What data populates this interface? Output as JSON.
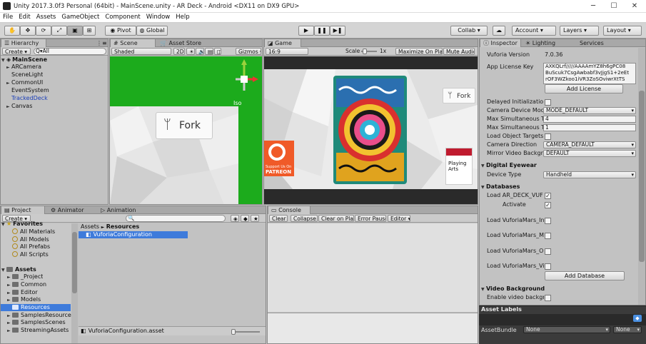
{
  "window": {
    "title": "Unity 2017.3.0f3 Personal (64bit) - MainScene.unity - AR Deck - Android <DX11 on DX9 GPU>"
  },
  "menu": [
    "File",
    "Edit",
    "Assets",
    "GameObject",
    "Component",
    "Window",
    "Help"
  ],
  "toolbar": {
    "pivot": "Pivot",
    "global": "Global",
    "collab": "Collab ▾",
    "account": "Account",
    "layers": "Layers",
    "layout": "Layout"
  },
  "hierarchy": {
    "tab": "Hierarchy",
    "create": "Create ▾",
    "search_placeholder": "Q▾All",
    "scene": "MainScene",
    "items": [
      "ARCamera",
      "SceneLight",
      "CommonUI",
      "EventSystem",
      "TrackedDeck",
      "Canvas"
    ]
  },
  "scene": {
    "tab_scene": "Scene",
    "tab_store": "Asset Store",
    "shaded": "Shaded",
    "mode2d": "2D",
    "gizmos": "Gizmos ▾",
    "search_placeholder": "Q▾All",
    "persp": "Iso",
    "fork": "Fork"
  },
  "game": {
    "tab": "Game",
    "aspect": "16:9",
    "scale_label": "Scale",
    "scale_value": "1x",
    "maximize": "Maximize On Play",
    "mute": "Mute Audio",
    "fork": "Fork",
    "playing_arts": "Playing Arts",
    "patreon_support": "Support Us On",
    "patreon": "PATREON"
  },
  "project": {
    "tab_project": "Project",
    "tab_animator": "Animator",
    "tab_animation": "Animation",
    "create": "Create ▾",
    "favorites_label": "Favorites",
    "favorites": [
      "All Materials",
      "All Models",
      "All Prefabs",
      "All Scripts"
    ],
    "assets_label": "Assets",
    "folders": [
      "_Project",
      "Common",
      "Editor",
      "Models",
      "Resources",
      "SamplesResource",
      "SamplesScenes",
      "StreamingAssets"
    ],
    "breadcrumb_root": "Assets",
    "breadcrumb_sep": "►",
    "breadcrumb_current": "Resources",
    "file": "VuforiaConfiguration",
    "footer_file": "VuforiaConfiguration.asset"
  },
  "console": {
    "tab": "Console",
    "clear": "Clear",
    "collapse": "Collapse",
    "clear_on_play": "Clear on Play",
    "error_pause": "Error Pause",
    "editor": "Editor ▾"
  },
  "inspector": {
    "tab_inspector": "Inspector",
    "tab_lighting": "Lighting",
    "tab_services": "Services",
    "vuforia_version_label": "Vuforia Version",
    "vuforia_version": "7.0.36",
    "license_label": "App License Key",
    "license_lines": [
      "AXKQLrf/////AAAAmYZ8h6gPC08",
      "BuScuk7CsgAwbabf3vJjgS1+2eEt",
      "rOF3WZkoo1iVR3ZoSOviwrXtTS"
    ],
    "add_license": "Add License",
    "delayed_init": "Delayed Initializatio",
    "camera_mode_label": "Camera Device Mod",
    "camera_mode": "MODE_DEFAULT",
    "max_sim1_label": "Max Simultaneous T",
    "max_sim1": "4",
    "max_sim2_label": "Max Simultaneous T",
    "max_sim2": "1",
    "load_targets": "Load Object Targets",
    "camera_dir_label": "Camera Direction",
    "camera_dir": "CAMERA_DEFAULT",
    "mirror_label": "Mirror Video Backgr",
    "mirror": "DEFAULT",
    "digital_eyewear": "Digital Eyewear",
    "device_type_label": "Device Type",
    "device_type": "Handheld",
    "databases": "Databases",
    "load_ar_deck": "Load AR_DECK_VUF",
    "activate": "Activate",
    "load_db1": "Load VuforiaMars_In",
    "load_db2": "Load VuforiaMars_M",
    "load_db3": "Load VuforiaMars_O",
    "load_db4": "Load VuforiaMars_Vi",
    "add_database": "Add Database",
    "video_background": "Video Background",
    "enable_video": "Enable video backgr",
    "asset_labels": "Asset Labels",
    "asset_bundle_label": "AssetBundle",
    "asset_bundle": "None",
    "asset_variant": "None"
  }
}
